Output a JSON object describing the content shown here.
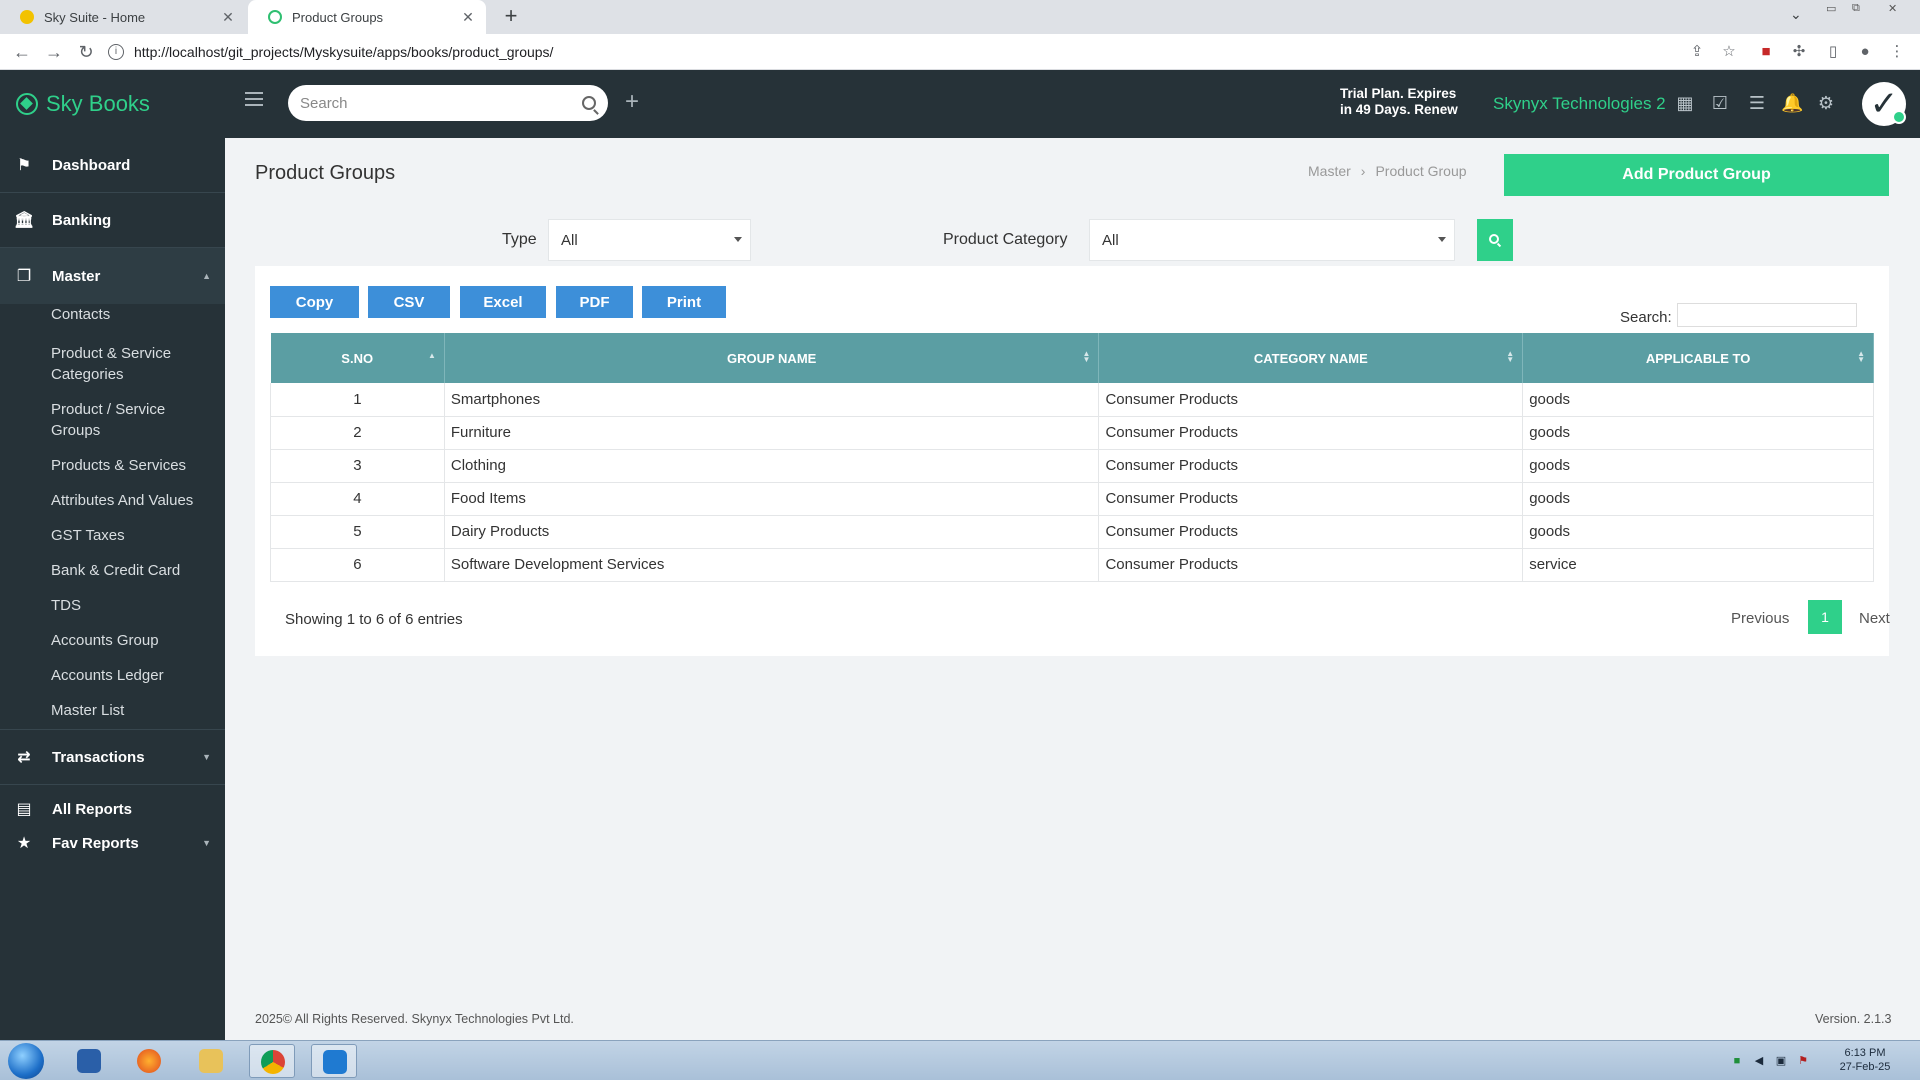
{
  "browser": {
    "tabs": [
      {
        "title": "Sky Suite - Home"
      },
      {
        "title": "Product Groups"
      }
    ],
    "url": "http://localhost/git_projects/Myskysuite/apps/books/product_groups/"
  },
  "app": {
    "brand": "Sky Books",
    "search_placeholder": "Search",
    "trial_text": "Trial Plan. Expires in 49 Days. Renew",
    "company": "Skynyx Technologies 2",
    "avatar_glyph": "✓"
  },
  "sidebar": {
    "menu": [
      {
        "label": "Dashboard",
        "icon": "flag-icon"
      },
      {
        "label": "Banking",
        "icon": "bank-icon"
      },
      {
        "label": "Master",
        "icon": "master-icon"
      },
      {
        "label": "Transactions",
        "icon": "transactions-icon"
      },
      {
        "label": "All Reports",
        "icon": "reports-icon"
      },
      {
        "label": "Fav Reports",
        "icon": "star-icon"
      }
    ],
    "master_items": [
      {
        "label": "Contacts"
      },
      {
        "label": "Product & Service Categories"
      },
      {
        "label": "Product / Service Groups"
      },
      {
        "label": "Products & Services"
      },
      {
        "label": "Attributes And Values"
      },
      {
        "label": "GST Taxes"
      },
      {
        "label": "Bank & Credit Card"
      },
      {
        "label": "TDS"
      },
      {
        "label": "Accounts Group"
      },
      {
        "label": "Accounts Ledger"
      },
      {
        "label": "Master List"
      }
    ]
  },
  "page": {
    "title": "Product Groups",
    "breadcrumb": [
      "Master",
      "Product Group"
    ],
    "add_button": "Add Product Group"
  },
  "filters": {
    "type_label": "Type",
    "type_value": "All",
    "category_label": "Product Category",
    "category_value": "All"
  },
  "export_buttons": [
    "Copy",
    "CSV",
    "Excel",
    "PDF",
    "Print"
  ],
  "table": {
    "search_label": "Search:",
    "columns": [
      "S.NO",
      "GROUP NAME",
      "CATEGORY NAME",
      "APPLICABLE TO"
    ],
    "rows": [
      {
        "sno": "1",
        "group": "Smartphones",
        "category": "Consumer Products",
        "applicable": "goods"
      },
      {
        "sno": "2",
        "group": "Furniture",
        "category": "Consumer Products",
        "applicable": "goods"
      },
      {
        "sno": "3",
        "group": "Clothing",
        "category": "Consumer Products",
        "applicable": "goods"
      },
      {
        "sno": "4",
        "group": "Food Items",
        "category": "Consumer Products",
        "applicable": "goods"
      },
      {
        "sno": "5",
        "group": "Dairy Products",
        "category": "Consumer Products",
        "applicable": "goods"
      },
      {
        "sno": "6",
        "group": "Software Development Services",
        "category": "Consumer Products",
        "applicable": "service"
      }
    ],
    "info": "Showing 1 to 6 of 6 entries",
    "pagination": {
      "previous": "Previous",
      "current": "1",
      "next": "Next"
    }
  },
  "footer": {
    "copyright": "2025© All Rights Reserved. Skynyx Technologies Pvt Ltd.",
    "version": "Version. 2.1.3"
  },
  "taskbar": {
    "time": "6:13 PM",
    "date": "27-Feb-25"
  },
  "colors": {
    "sidebar_bg": "#263238",
    "accent_green": "#2fd08a",
    "table_header": "#5b9ea3",
    "export_blue": "#3d8fd9"
  }
}
